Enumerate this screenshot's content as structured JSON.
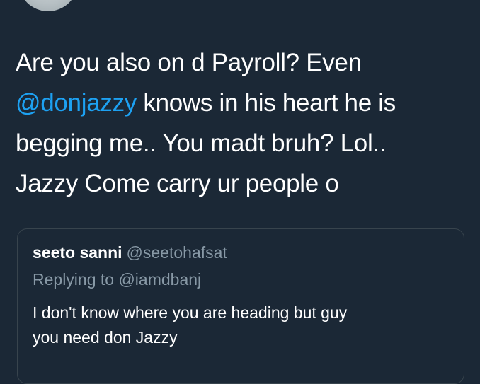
{
  "tweet": {
    "avatar_icon": "user-avatar",
    "text_lines": [
      {
        "segments": [
          {
            "text": "Are you also on d Payroll? Even ",
            "mention": false
          }
        ]
      },
      {
        "segments": [
          {
            "text": "@donjazzy",
            "mention": true
          },
          {
            "text": " knows in his heart he is",
            "mention": false
          }
        ]
      },
      {
        "segments": [
          {
            "text": "begging me.. You madt bruh? Lol..",
            "mention": false
          }
        ]
      },
      {
        "segments": [
          {
            "text": "Jazzy Come carry ur people o",
            "mention": false
          }
        ]
      }
    ]
  },
  "quoted_tweet": {
    "name": "seeto sanni",
    "handle": "@seetohafsat",
    "replying_to": "Replying to @iamdbanj",
    "body_lines": [
      "I don't know where you are heading but guy",
      "you need don Jazzy"
    ]
  },
  "colors": {
    "background": "#1b2836",
    "text": "#ffffff",
    "mention": "#1da1f2",
    "secondary": "#8899a6",
    "border": "#38444d"
  }
}
